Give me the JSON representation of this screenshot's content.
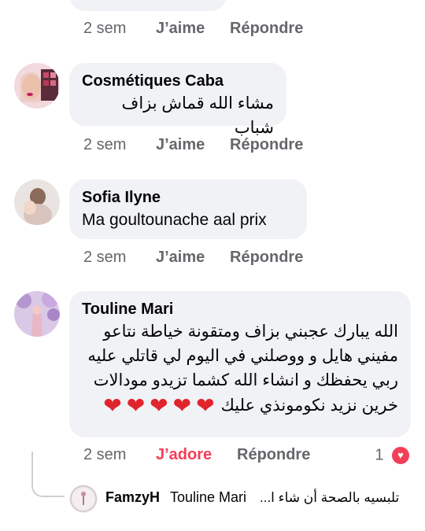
{
  "top_comment": {
    "actions": {
      "time": "2 sem",
      "like": "J’aime",
      "reply": "Répondre"
    }
  },
  "comments": [
    {
      "author": "Cosmétiques Caba",
      "text": "مشاء الله  قماش بزاف شباب",
      "actions": {
        "time": "2 sem",
        "like": "J’aime",
        "reply": "Répondre"
      }
    },
    {
      "author": "Sofia Ilyne",
      "text": "Ma goultounache aal prix",
      "actions": {
        "time": "2 sem",
        "like": "J’aime",
        "reply": "Répondre"
      }
    },
    {
      "author": "Touline Mari",
      "lines": [
        "الله يبارك عجبني بزاف ومتقونة خياطة نتاعو",
        "مفيني هايل و ووصلني في اليوم لي قاتلي عليه",
        "ربي يحفظك و انشاء الله كشما تزيدو مودالات",
        "خرين نزيد نكومونذي عليك"
      ],
      "hearts": [
        "❤",
        "❤",
        "❤",
        "❤",
        "❤"
      ],
      "actions": {
        "time": "2 sem",
        "like": "J’adore",
        "reply": "Répondre"
      },
      "reaction_count": "1",
      "reaction_icon": "heart-reaction-icon"
    }
  ],
  "reply_preview": {
    "author": "FamzyH",
    "mention": "Touline Mari",
    "text": "تلبسيه بالصحة أن شاء ا..."
  },
  "colors": {
    "bubble": "#f0f2f5",
    "meta": "#65676b",
    "love": "#e0242c"
  }
}
